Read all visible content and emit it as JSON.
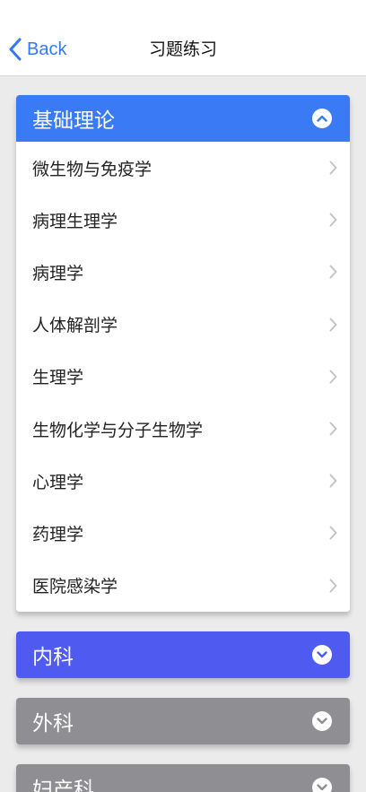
{
  "nav": {
    "back_label": "Back",
    "title": "习题练习"
  },
  "colors": {
    "accent_blue": "#3478f6",
    "section_open": "#3a7af5",
    "section_purple": "#4f5bf0",
    "section_gray": "#8e8e93"
  },
  "sections": [
    {
      "title": "基础理论",
      "state": "expanded",
      "toggle_icon": "chevron-up-circle-icon",
      "items": [
        {
          "label": "微生物与免疫学"
        },
        {
          "label": "病理生理学"
        },
        {
          "label": "病理学"
        },
        {
          "label": "人体解剖学"
        },
        {
          "label": "生理学"
        },
        {
          "label": "生物化学与分子生物学"
        },
        {
          "label": "心理学"
        },
        {
          "label": "药理学"
        },
        {
          "label": "医院感染学"
        }
      ]
    },
    {
      "title": "内科",
      "state": "collapsed",
      "toggle_icon": "chevron-down-circle-icon"
    },
    {
      "title": "外科",
      "state": "collapsed",
      "toggle_icon": "chevron-down-circle-icon"
    },
    {
      "title": "妇产科",
      "state": "collapsed",
      "toggle_icon": "chevron-down-circle-icon"
    }
  ]
}
